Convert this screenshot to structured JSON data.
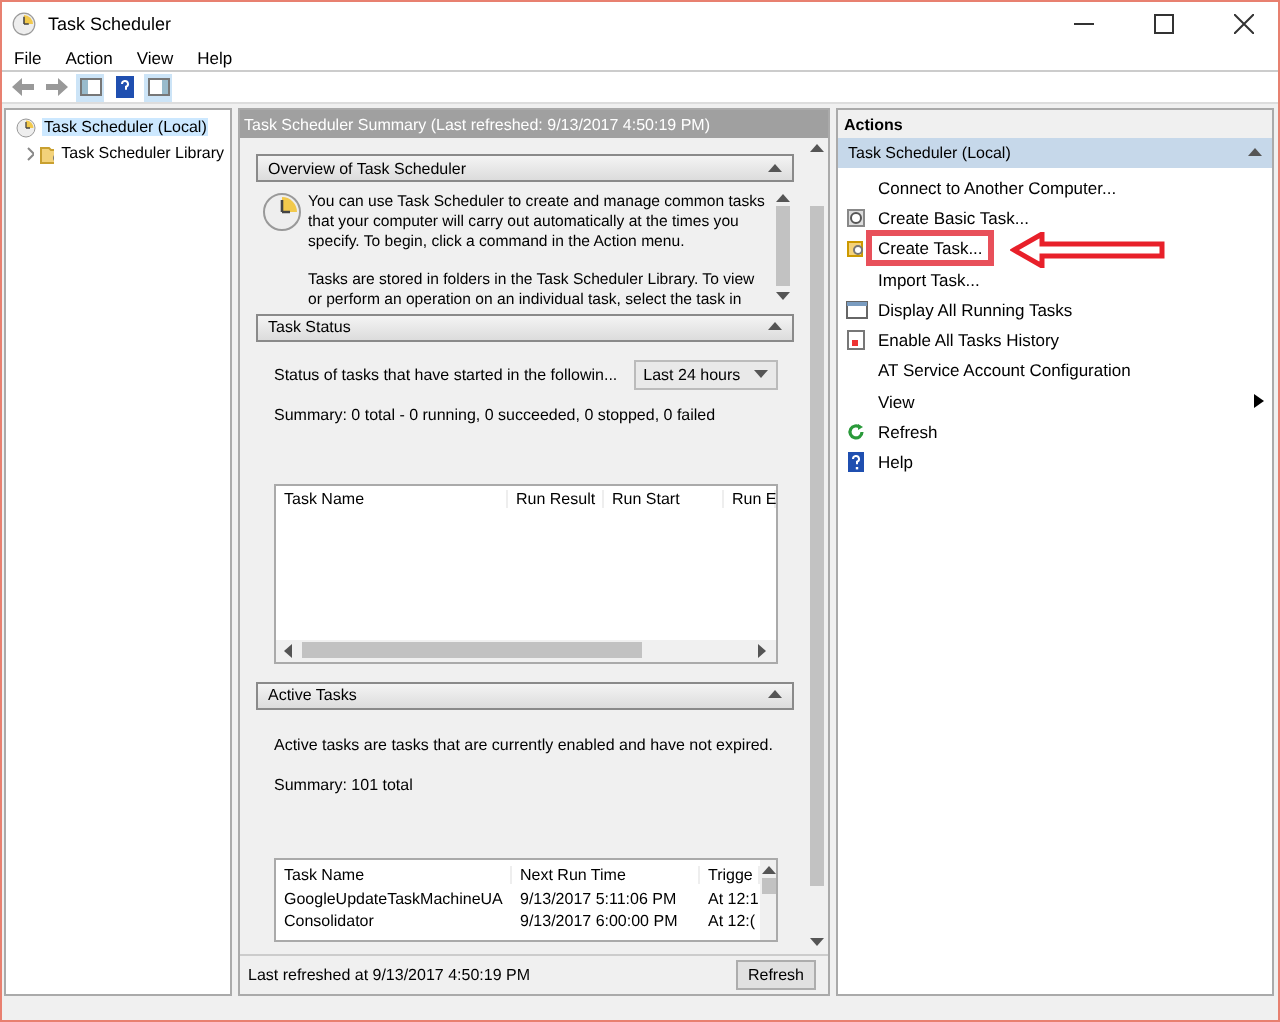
{
  "window": {
    "title": "Task Scheduler"
  },
  "menu": [
    "File",
    "Action",
    "View",
    "Help"
  ],
  "tree": [
    {
      "label": "Task Scheduler (Local)",
      "selected": true,
      "children": [
        {
          "label": "Task Scheduler Library",
          "selected": false
        }
      ]
    }
  ],
  "summary": {
    "header": "Task Scheduler Summary (Last refreshed: 9/13/2017 4:50:19 PM)",
    "overview": {
      "title": "Overview of Task Scheduler",
      "paragraphs": [
        "You can use Task Scheduler to create and manage common tasks that your computer will carry out automatically at the times you specify. To begin, click a command in the Action menu.",
        "Tasks are stored in folders in the Task Scheduler Library. To view or perform an operation on an individual task, select the task in"
      ]
    },
    "task_status": {
      "title": "Task Status",
      "label": "Status of tasks that have started in the followin...",
      "period": "Last 24 hours",
      "summary": "Summary: 0 total - 0 running, 0 succeeded, 0 stopped, 0 failed",
      "columns": [
        "Task Name",
        "Run Result",
        "Run Start",
        "Run E"
      ]
    },
    "active_tasks": {
      "title": "Active Tasks",
      "description": "Active tasks are tasks that are currently enabled and have not expired.",
      "summary": "Summary: 101 total",
      "columns": [
        "Task Name",
        "Next Run Time",
        "Trigge"
      ],
      "rows": [
        [
          "GoogleUpdateTaskMachineUA",
          "9/13/2017 5:11:06 PM",
          "At 12:1"
        ],
        [
          "Consolidator",
          "9/13/2017 6:00:00 PM",
          "At 12:("
        ]
      ]
    },
    "footer": "Last refreshed at 9/13/2017 4:50:19 PM",
    "refresh": "Refresh"
  },
  "actions": {
    "header": "Actions",
    "group": "Task Scheduler (Local)",
    "items": [
      {
        "label": "Connect to Another Computer...",
        "kind": "plain",
        "submenu": false,
        "highlighted": false
      },
      {
        "label": "Create Basic Task...",
        "kind": "wizard",
        "submenu": false,
        "highlighted": false
      },
      {
        "label": "Create Task...",
        "kind": "task",
        "submenu": false,
        "highlighted": true
      },
      {
        "label": "Import Task...",
        "kind": "plain",
        "submenu": false,
        "highlighted": false
      },
      {
        "label": "Display All Running Tasks",
        "kind": "window",
        "submenu": false,
        "highlighted": false
      },
      {
        "label": "Enable All Tasks History",
        "kind": "history",
        "submenu": false,
        "highlighted": false
      },
      {
        "label": "AT Service Account Configuration",
        "kind": "plain",
        "submenu": false,
        "highlighted": false
      },
      {
        "label": "View",
        "kind": "plain",
        "submenu": true,
        "highlighted": false
      },
      {
        "label": "Refresh",
        "kind": "refresh",
        "submenu": false,
        "highlighted": false
      },
      {
        "label": "Help",
        "kind": "help",
        "submenu": false,
        "highlighted": false
      }
    ]
  }
}
